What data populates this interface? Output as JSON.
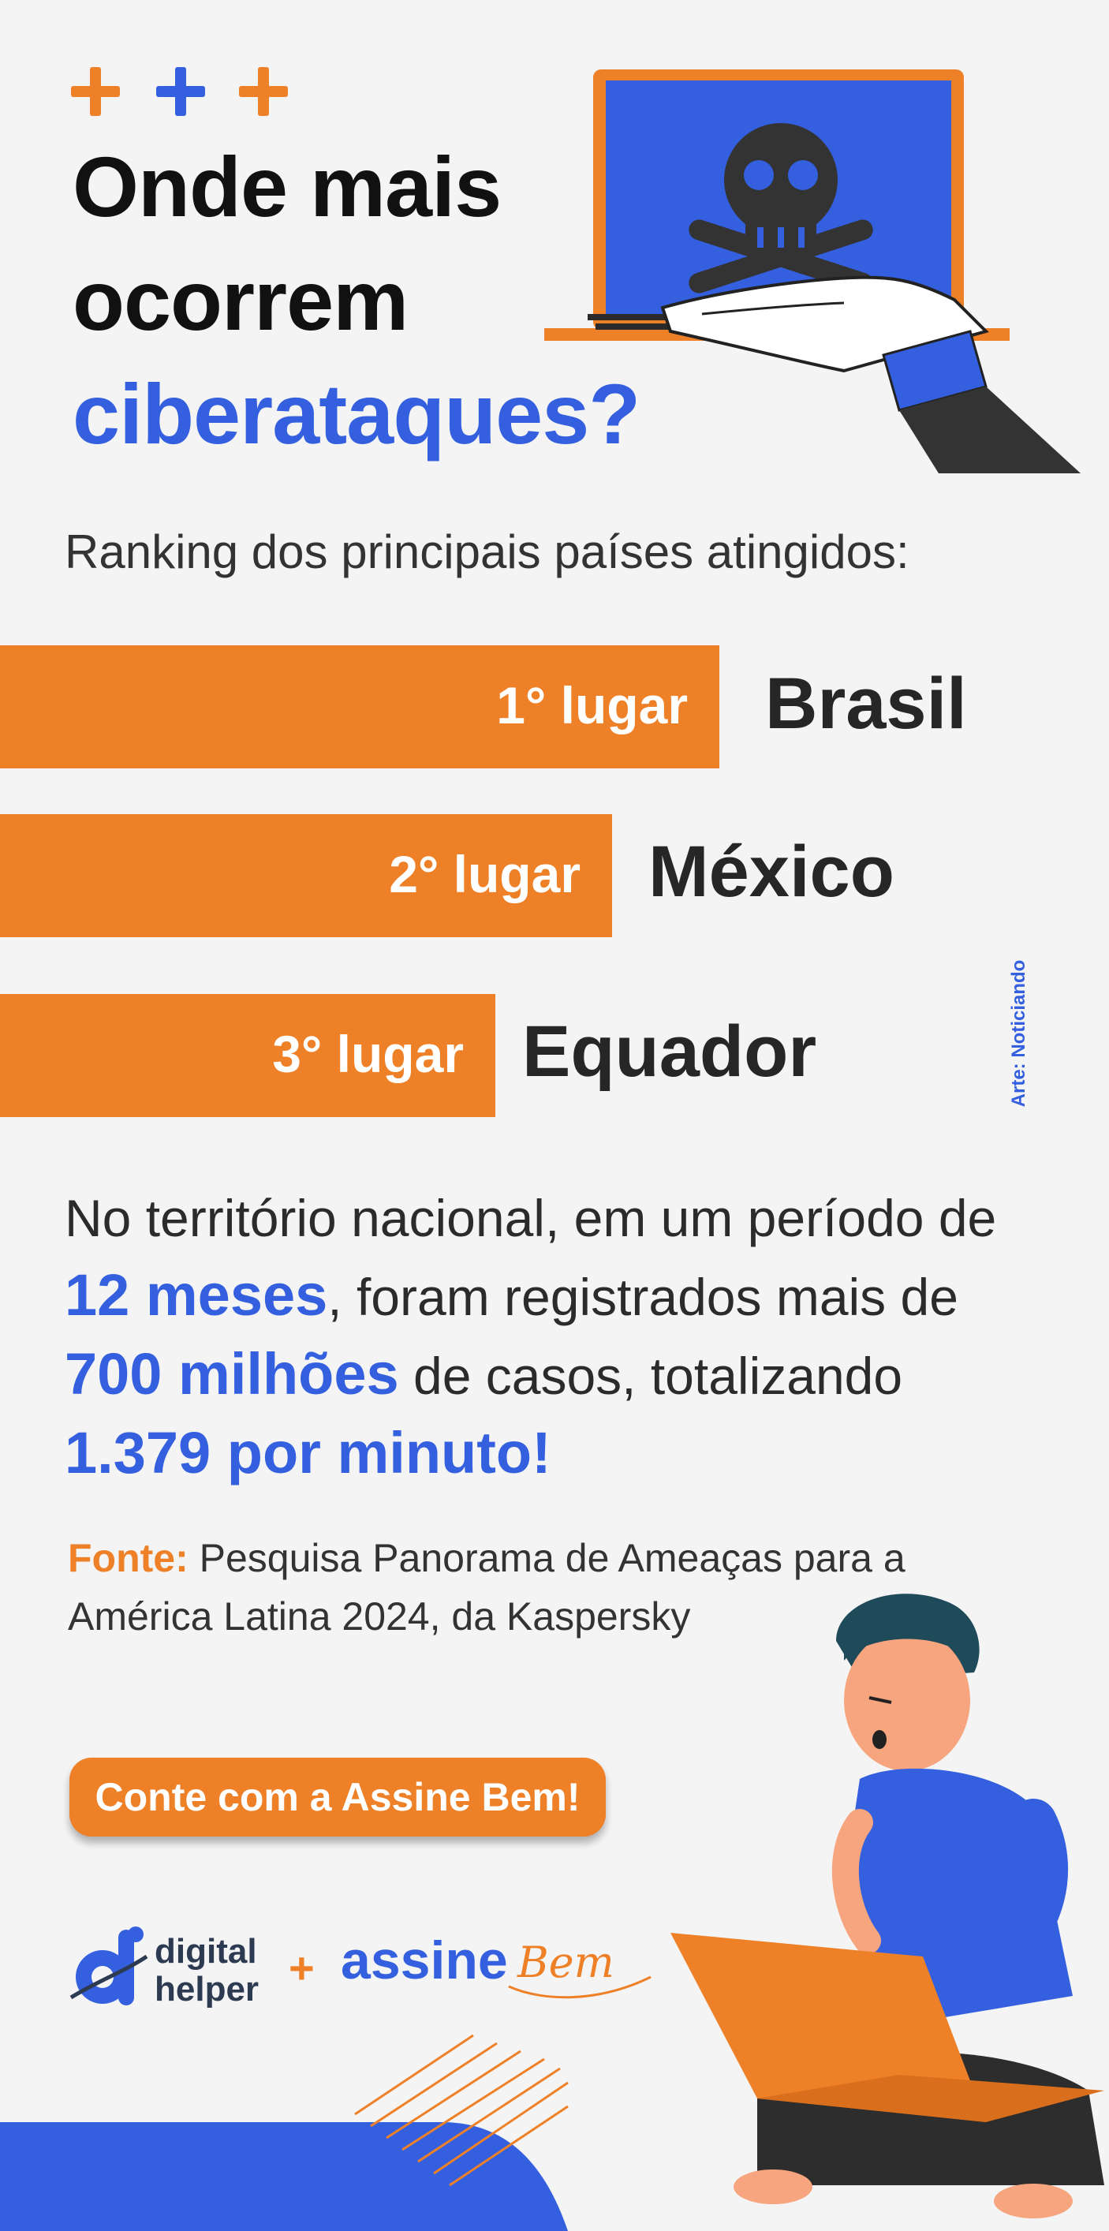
{
  "title": {
    "line1": "Onde mais",
    "line2": "ocorrem",
    "line3": "ciberataques?"
  },
  "subtitle": "Ranking dos principais países atingidos:",
  "ranking": [
    {
      "place": "1° lugar",
      "country": "Brasil"
    },
    {
      "place": "2° lugar",
      "country": "México"
    },
    {
      "place": "3° lugar",
      "country": "Equador"
    }
  ],
  "stats": {
    "t1": "No território nacional, em um período de ",
    "h1": "12 meses",
    "t2": ", foram registrados mais de ",
    "h2": "700 milhões",
    "t3": " de casos, totalizando ",
    "h3": "1.379 por minuto!"
  },
  "source": {
    "label": "Fonte:",
    "text": " Pesquisa Panorama de Ameaças para a América Latina 2024, da Kaspersky"
  },
  "cta_label": "Conte com a Assine Bem!",
  "credit": "Arte: Noticiando",
  "logos": {
    "digital_line1": "digital",
    "digital_line2": "helper",
    "plus": "+",
    "assine": "assine",
    "bem": "Bem"
  },
  "colors": {
    "orange": "#ee8028",
    "blue": "#3460df",
    "dark": "#2b2b2b",
    "background": "#f4f4f4"
  },
  "icons": [
    "plus-icon",
    "laptop-skull-icon",
    "hacker-hand-icon",
    "digital-helper-logo",
    "assine-bem-logo",
    "person-with-laptop-illustration"
  ]
}
